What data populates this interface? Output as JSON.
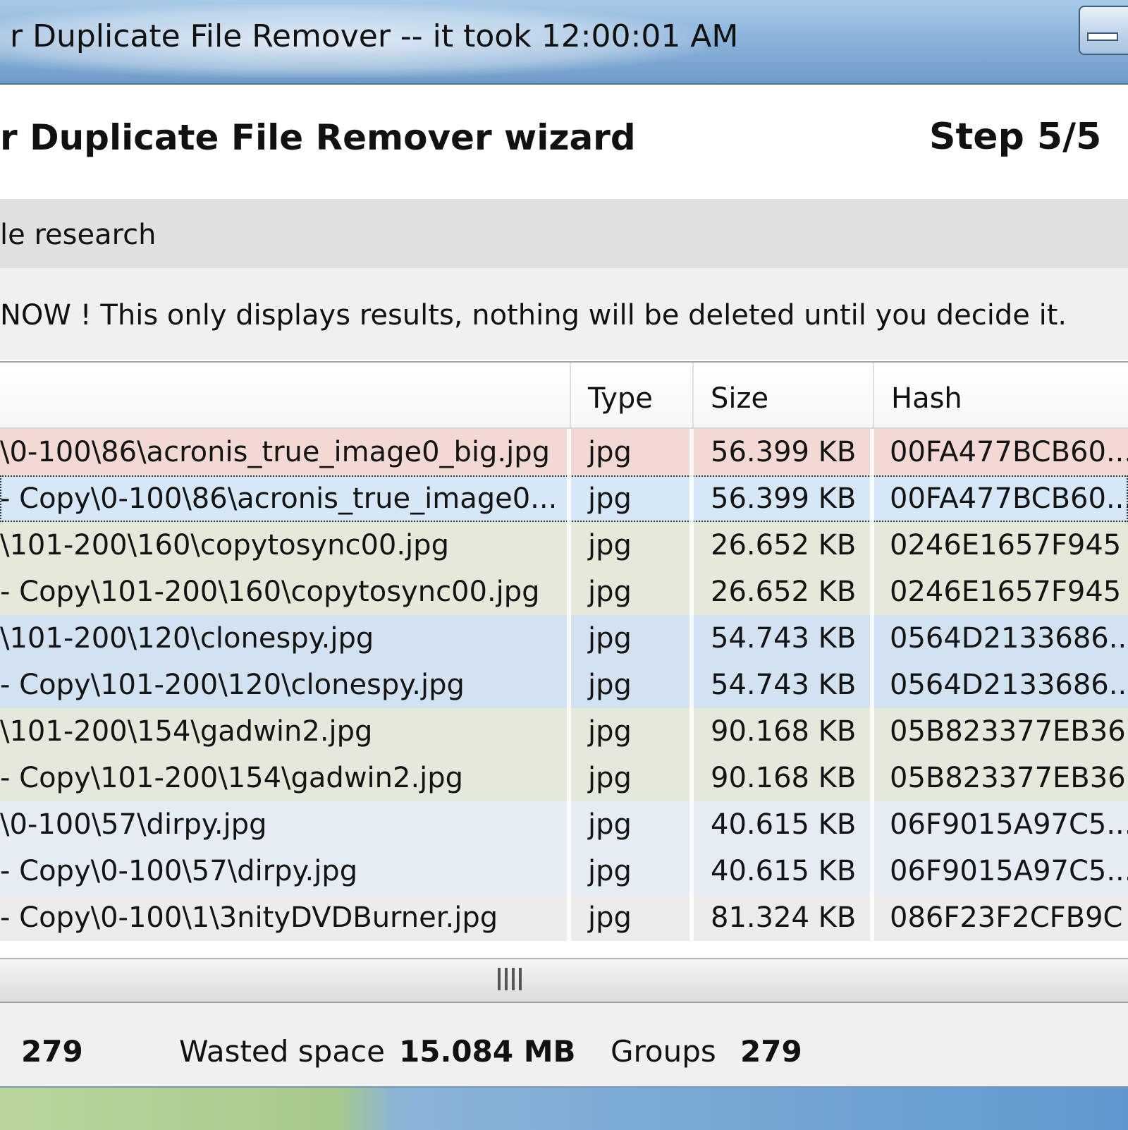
{
  "window": {
    "title": "r Duplicate File Remover -- it took 12:00:01 AM"
  },
  "wizard": {
    "title": "r Duplicate File Remover wizard",
    "step": "Step 5/5"
  },
  "section": {
    "label": "le research"
  },
  "notice": {
    "text": "NOW ! This only displays results, nothing will be deleted until you decide it."
  },
  "table": {
    "columns": [
      "",
      "Type",
      "Size",
      "Hash"
    ],
    "rows": [
      {
        "path": "\\0-100\\86\\acronis_true_image0_big.jpg",
        "type": "jpg",
        "size": "56.399 KB",
        "hash": "00FA477BCB60...",
        "color": "#f2d9d3",
        "selected": false
      },
      {
        "path": " - Copy\\0-100\\86\\acronis_true_image0...",
        "type": "jpg",
        "size": "56.399 KB",
        "hash": "00FA477BCB60...",
        "color": "#d6e7f8",
        "selected": true
      },
      {
        "path": "\\101-200\\160\\copytosync00.jpg",
        "type": "jpg",
        "size": "26.652 KB",
        "hash": "0246E1657F945",
        "color": "#e4e9d9",
        "selected": false
      },
      {
        "path": " - Copy\\101-200\\160\\copytosync00.jpg",
        "type": "jpg",
        "size": "26.652 KB",
        "hash": "0246E1657F945",
        "color": "#e4e9d9",
        "selected": false
      },
      {
        "path": "\\101-200\\120\\clonespy.jpg",
        "type": "jpg",
        "size": "54.743 KB",
        "hash": "0564D2133686...",
        "color": "#d3e2f1",
        "selected": false
      },
      {
        "path": " - Copy\\101-200\\120\\clonespy.jpg",
        "type": "jpg",
        "size": "54.743 KB",
        "hash": "0564D2133686...",
        "color": "#d3e2f1",
        "selected": false
      },
      {
        "path": "\\101-200\\154\\gadwin2.jpg",
        "type": "jpg",
        "size": "90.168 KB",
        "hash": "05B823377EB36",
        "color": "#e3eadb",
        "selected": false
      },
      {
        "path": " - Copy\\101-200\\154\\gadwin2.jpg",
        "type": "jpg",
        "size": "90.168 KB",
        "hash": "05B823377EB36",
        "color": "#e3eadb",
        "selected": false
      },
      {
        "path": "\\0-100\\57\\dirpy.jpg",
        "type": "jpg",
        "size": "40.615 KB",
        "hash": "06F9015A97C5...",
        "color": "#e6ecf4",
        "selected": false
      },
      {
        "path": " - Copy\\0-100\\57\\dirpy.jpg",
        "type": "jpg",
        "size": "40.615 KB",
        "hash": "06F9015A97C5...",
        "color": "#e6ecf4",
        "selected": false
      },
      {
        "path": " - Copy\\0-100\\1\\3nityDVDBurner.jpg",
        "type": "jpg",
        "size": "81.324 KB",
        "hash": "086F23F2CFB9C",
        "color": "#ececec",
        "selected": false
      }
    ]
  },
  "status": {
    "count_value": "279",
    "wasted_label": "Wasted space",
    "wasted_value": "15.084 MB",
    "groups_label": "Groups",
    "groups_value": "279"
  },
  "icons": {
    "window_button": "minimize-icon",
    "scroll_grip": "scroll-grip-icon"
  }
}
